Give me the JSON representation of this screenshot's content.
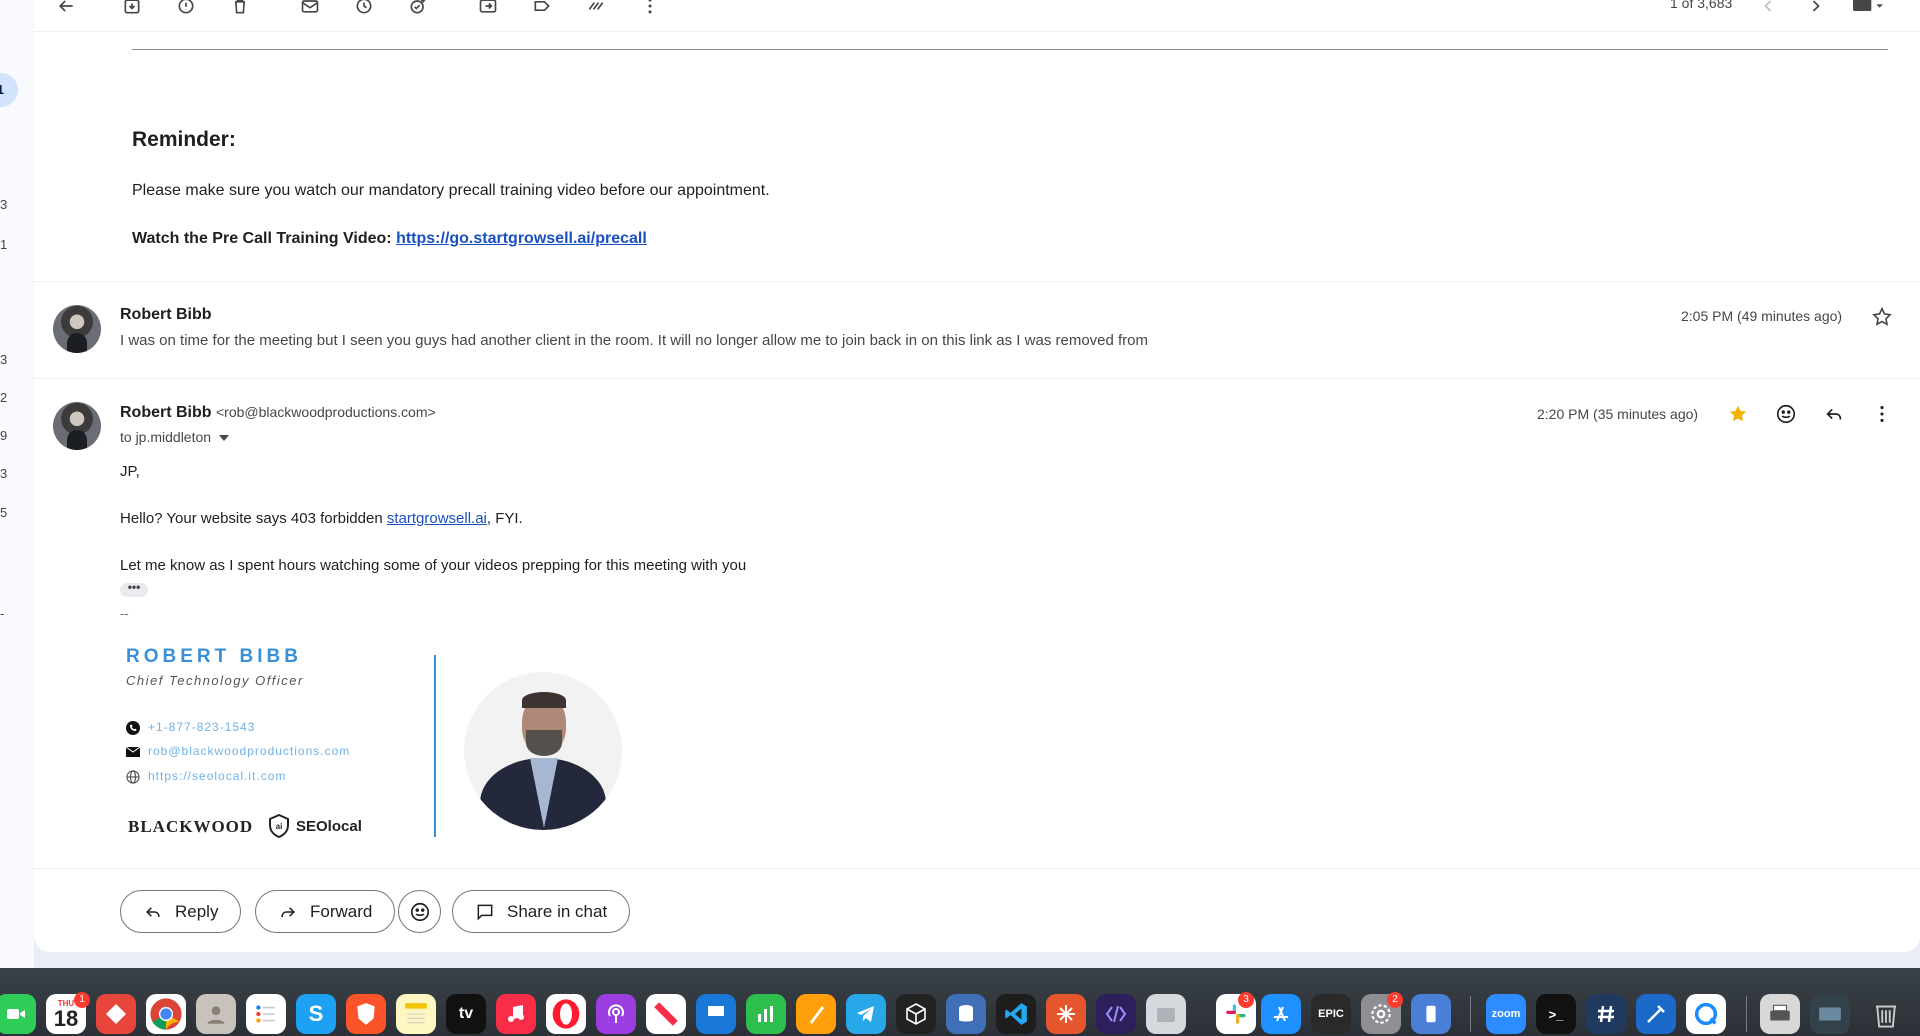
{
  "sidebar": {
    "active_count": "1",
    "counts": [
      "3",
      "1",
      "3",
      "2",
      "9",
      "3",
      "5",
      "-"
    ]
  },
  "toolbar": {
    "pager": "1 of 3,683",
    "icons": [
      "back-arrow-icon",
      "archive-icon",
      "report-spam-icon",
      "delete-icon",
      "mark-unread-icon",
      "snooze-icon",
      "add-task-icon",
      "move-to-icon",
      "label-icon",
      "filter-icon",
      "more-vert-icon",
      "chevron-left-icon",
      "chevron-right-icon",
      "keyboard-icon"
    ]
  },
  "reminder": {
    "title": "Reminder:",
    "text": "Please make sure you watch our mandatory precall training video before our appointment.",
    "link_label": "Watch the Pre Call Training Video:",
    "link": "https://go.startgrowsell.ai/precall"
  },
  "message1": {
    "sender": "Robert Bibb",
    "snippet": "I was on time for the meeting but I seen you guys had another client in the room. It will no longer allow me to join back in on this link as I was removed from",
    "time": "2:05 PM (49 minutes ago)"
  },
  "message2": {
    "sender": "Robert Bibb",
    "email": "<rob@blackwoodproductions.com>",
    "to": "to jp.middleton",
    "time": "2:20 PM (35 minutes ago)",
    "greeting": "JP,",
    "line1_before": "Hello? Your website says 403 forbidden ",
    "line1_link": "startgrowsell.ai",
    "line1_after": ", FYI.",
    "line2": "Let me know as I spent hours watching some of your videos prepping for this meeting with you",
    "ellipsis": "•••",
    "sig_dash": "--"
  },
  "signature": {
    "name": "ROBERT BIBB",
    "role": "Chief Technology Officer",
    "phone": "+1-877-823-1543",
    "email": "rob@blackwoodproductions.com",
    "website": "https://seolocal.it.com",
    "logo1": "BLACKWOOD",
    "logo2": "SEOlocal",
    "logo2_mark": "ai"
  },
  "actions": {
    "reply": "Reply",
    "forward": "Forward",
    "share": "Share in chat"
  },
  "dock": {
    "calendar_day": "THU",
    "calendar_date": "18",
    "calendar_badge": "1",
    "slack_badge": "3",
    "settings_badge": "2",
    "tv_label": "tv",
    "zoom_label": "zoom",
    "epic_label": "EPIC",
    "skype_label": "S",
    "terminal_label": ">_"
  }
}
